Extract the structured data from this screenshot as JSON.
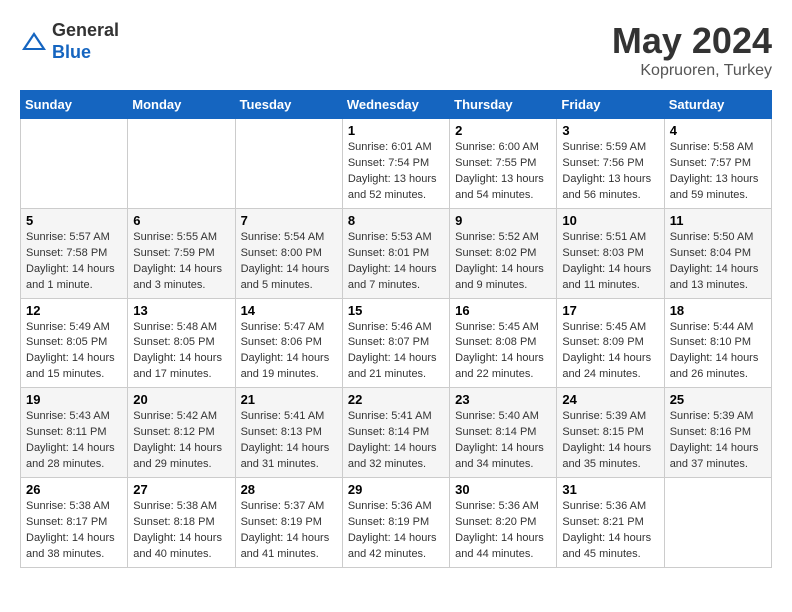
{
  "header": {
    "logo_general": "General",
    "logo_blue": "Blue",
    "title": "May 2024",
    "subtitle": "Kopruoren, Turkey"
  },
  "weekdays": [
    "Sunday",
    "Monday",
    "Tuesday",
    "Wednesday",
    "Thursday",
    "Friday",
    "Saturday"
  ],
  "weeks": [
    [
      {
        "day": "",
        "sunrise": "",
        "sunset": "",
        "daylight": ""
      },
      {
        "day": "",
        "sunrise": "",
        "sunset": "",
        "daylight": ""
      },
      {
        "day": "",
        "sunrise": "",
        "sunset": "",
        "daylight": ""
      },
      {
        "day": "1",
        "sunrise": "Sunrise: 6:01 AM",
        "sunset": "Sunset: 7:54 PM",
        "daylight": "Daylight: 13 hours and 52 minutes."
      },
      {
        "day": "2",
        "sunrise": "Sunrise: 6:00 AM",
        "sunset": "Sunset: 7:55 PM",
        "daylight": "Daylight: 13 hours and 54 minutes."
      },
      {
        "day": "3",
        "sunrise": "Sunrise: 5:59 AM",
        "sunset": "Sunset: 7:56 PM",
        "daylight": "Daylight: 13 hours and 56 minutes."
      },
      {
        "day": "4",
        "sunrise": "Sunrise: 5:58 AM",
        "sunset": "Sunset: 7:57 PM",
        "daylight": "Daylight: 13 hours and 59 minutes."
      }
    ],
    [
      {
        "day": "5",
        "sunrise": "Sunrise: 5:57 AM",
        "sunset": "Sunset: 7:58 PM",
        "daylight": "Daylight: 14 hours and 1 minute."
      },
      {
        "day": "6",
        "sunrise": "Sunrise: 5:55 AM",
        "sunset": "Sunset: 7:59 PM",
        "daylight": "Daylight: 14 hours and 3 minutes."
      },
      {
        "day": "7",
        "sunrise": "Sunrise: 5:54 AM",
        "sunset": "Sunset: 8:00 PM",
        "daylight": "Daylight: 14 hours and 5 minutes."
      },
      {
        "day": "8",
        "sunrise": "Sunrise: 5:53 AM",
        "sunset": "Sunset: 8:01 PM",
        "daylight": "Daylight: 14 hours and 7 minutes."
      },
      {
        "day": "9",
        "sunrise": "Sunrise: 5:52 AM",
        "sunset": "Sunset: 8:02 PM",
        "daylight": "Daylight: 14 hours and 9 minutes."
      },
      {
        "day": "10",
        "sunrise": "Sunrise: 5:51 AM",
        "sunset": "Sunset: 8:03 PM",
        "daylight": "Daylight: 14 hours and 11 minutes."
      },
      {
        "day": "11",
        "sunrise": "Sunrise: 5:50 AM",
        "sunset": "Sunset: 8:04 PM",
        "daylight": "Daylight: 14 hours and 13 minutes."
      }
    ],
    [
      {
        "day": "12",
        "sunrise": "Sunrise: 5:49 AM",
        "sunset": "Sunset: 8:05 PM",
        "daylight": "Daylight: 14 hours and 15 minutes."
      },
      {
        "day": "13",
        "sunrise": "Sunrise: 5:48 AM",
        "sunset": "Sunset: 8:05 PM",
        "daylight": "Daylight: 14 hours and 17 minutes."
      },
      {
        "day": "14",
        "sunrise": "Sunrise: 5:47 AM",
        "sunset": "Sunset: 8:06 PM",
        "daylight": "Daylight: 14 hours and 19 minutes."
      },
      {
        "day": "15",
        "sunrise": "Sunrise: 5:46 AM",
        "sunset": "Sunset: 8:07 PM",
        "daylight": "Daylight: 14 hours and 21 minutes."
      },
      {
        "day": "16",
        "sunrise": "Sunrise: 5:45 AM",
        "sunset": "Sunset: 8:08 PM",
        "daylight": "Daylight: 14 hours and 22 minutes."
      },
      {
        "day": "17",
        "sunrise": "Sunrise: 5:45 AM",
        "sunset": "Sunset: 8:09 PM",
        "daylight": "Daylight: 14 hours and 24 minutes."
      },
      {
        "day": "18",
        "sunrise": "Sunrise: 5:44 AM",
        "sunset": "Sunset: 8:10 PM",
        "daylight": "Daylight: 14 hours and 26 minutes."
      }
    ],
    [
      {
        "day": "19",
        "sunrise": "Sunrise: 5:43 AM",
        "sunset": "Sunset: 8:11 PM",
        "daylight": "Daylight: 14 hours and 28 minutes."
      },
      {
        "day": "20",
        "sunrise": "Sunrise: 5:42 AM",
        "sunset": "Sunset: 8:12 PM",
        "daylight": "Daylight: 14 hours and 29 minutes."
      },
      {
        "day": "21",
        "sunrise": "Sunrise: 5:41 AM",
        "sunset": "Sunset: 8:13 PM",
        "daylight": "Daylight: 14 hours and 31 minutes."
      },
      {
        "day": "22",
        "sunrise": "Sunrise: 5:41 AM",
        "sunset": "Sunset: 8:14 PM",
        "daylight": "Daylight: 14 hours and 32 minutes."
      },
      {
        "day": "23",
        "sunrise": "Sunrise: 5:40 AM",
        "sunset": "Sunset: 8:14 PM",
        "daylight": "Daylight: 14 hours and 34 minutes."
      },
      {
        "day": "24",
        "sunrise": "Sunrise: 5:39 AM",
        "sunset": "Sunset: 8:15 PM",
        "daylight": "Daylight: 14 hours and 35 minutes."
      },
      {
        "day": "25",
        "sunrise": "Sunrise: 5:39 AM",
        "sunset": "Sunset: 8:16 PM",
        "daylight": "Daylight: 14 hours and 37 minutes."
      }
    ],
    [
      {
        "day": "26",
        "sunrise": "Sunrise: 5:38 AM",
        "sunset": "Sunset: 8:17 PM",
        "daylight": "Daylight: 14 hours and 38 minutes."
      },
      {
        "day": "27",
        "sunrise": "Sunrise: 5:38 AM",
        "sunset": "Sunset: 8:18 PM",
        "daylight": "Daylight: 14 hours and 40 minutes."
      },
      {
        "day": "28",
        "sunrise": "Sunrise: 5:37 AM",
        "sunset": "Sunset: 8:19 PM",
        "daylight": "Daylight: 14 hours and 41 minutes."
      },
      {
        "day": "29",
        "sunrise": "Sunrise: 5:36 AM",
        "sunset": "Sunset: 8:19 PM",
        "daylight": "Daylight: 14 hours and 42 minutes."
      },
      {
        "day": "30",
        "sunrise": "Sunrise: 5:36 AM",
        "sunset": "Sunset: 8:20 PM",
        "daylight": "Daylight: 14 hours and 44 minutes."
      },
      {
        "day": "31",
        "sunrise": "Sunrise: 5:36 AM",
        "sunset": "Sunset: 8:21 PM",
        "daylight": "Daylight: 14 hours and 45 minutes."
      },
      {
        "day": "",
        "sunrise": "",
        "sunset": "",
        "daylight": ""
      }
    ]
  ]
}
